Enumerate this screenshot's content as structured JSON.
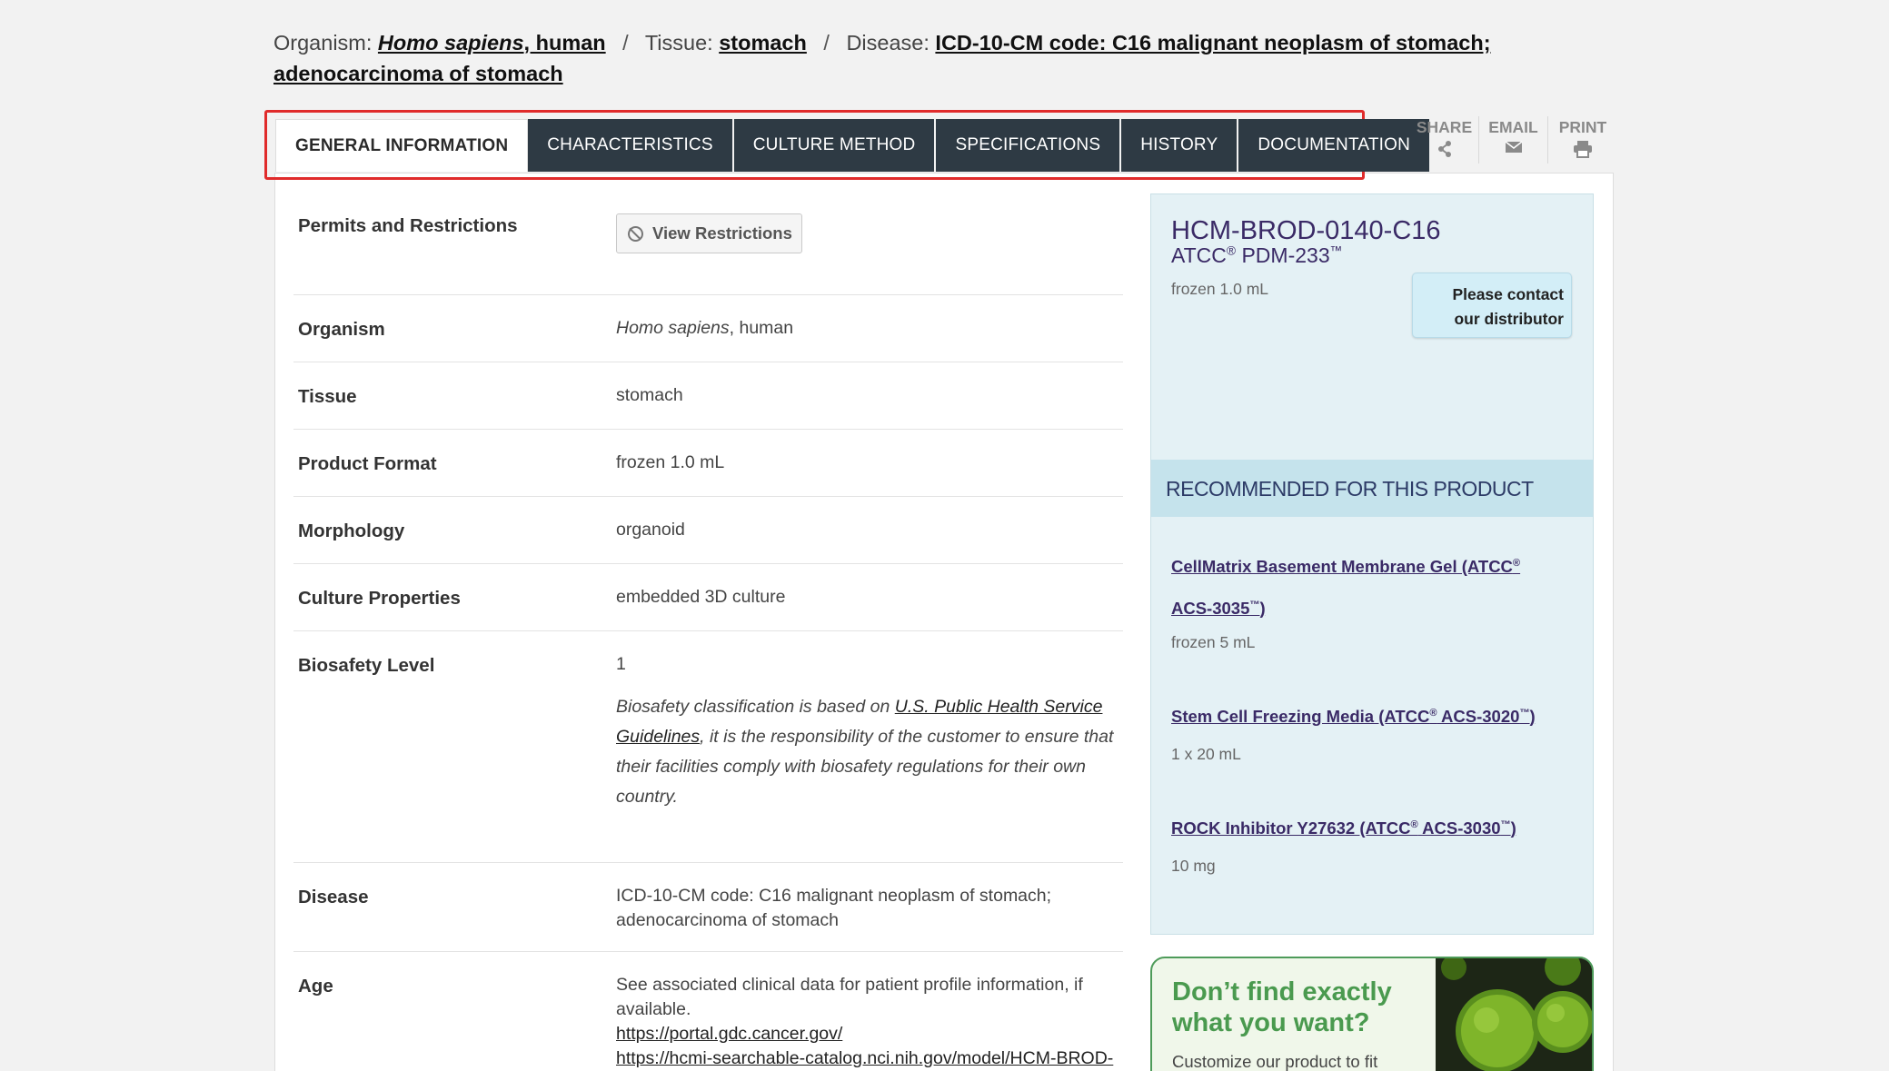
{
  "breadcrumb": {
    "organism_label": "Organism:",
    "organism_value_italic": "Homo sapiens",
    "organism_value_rest": ", human",
    "tissue_label": "Tissue:",
    "tissue_value": "stomach",
    "disease_label": "Disease:",
    "disease_value": "ICD-10-CM code: C16 malignant neoplasm of stomach; adenocarcinoma of stomach",
    "separator": "/"
  },
  "tabs": [
    {
      "label": "GENERAL INFORMATION",
      "active": true
    },
    {
      "label": "CHARACTERISTICS",
      "active": false
    },
    {
      "label": "CULTURE METHOD",
      "active": false
    },
    {
      "label": "SPECIFICATIONS",
      "active": false
    },
    {
      "label": "HISTORY",
      "active": false
    },
    {
      "label": "DOCUMENTATION",
      "active": false
    }
  ],
  "tools": {
    "share": "SHARE",
    "email": "EMAIL",
    "print": "PRINT"
  },
  "details": {
    "permits_label": "Permits and Restrictions",
    "restrictions_button": "View Restrictions",
    "organism_label": "Organism",
    "organism_italic": "Homo sapiens",
    "organism_rest": ", human",
    "tissue_label": "Tissue",
    "tissue_value": "stomach",
    "format_label": "Product Format",
    "format_value": "frozen 1.0 mL",
    "morphology_label": "Morphology",
    "morphology_value": "organoid",
    "culture_label": "Culture Properties",
    "culture_value": "embedded 3D culture",
    "biosafety_label": "Biosafety Level",
    "biosafety_value": "1",
    "biosafety_note_pre": "Biosafety classification is based on ",
    "biosafety_note_link": "U.S. Public Health Service Guidelines",
    "biosafety_note_post": ", it is the responsibility of the customer to ensure that their facilities comply with biosafety regulations for their own country.",
    "disease_label": "Disease",
    "disease_value": "ICD-10-CM code: C16 malignant neoplasm of stomach; adenocarcinoma of stomach",
    "age_label": "Age",
    "age_value": "See associated clinical data for patient profile information, if available.",
    "age_link1": "https://portal.gdc.cancer.gov/",
    "age_link2": "https://hcmi-searchable-catalog.nci.nih.gov/model/HCM-BROD-"
  },
  "product": {
    "id": "HCM-BROD-0140-C16",
    "atcc_prefix": "ATCC",
    "atcc_reg": "®",
    "atcc_code": " PDM-233",
    "atcc_tm": "™",
    "format": "frozen 1.0 mL",
    "contact_line1": "Please contact",
    "contact_line2": "our distributor",
    "recommended_heading": "RECOMMENDED FOR THIS PRODUCT",
    "recommended": [
      {
        "name": "CellMatrix Basement Membrane Gel (ATCC",
        "code": "ACS-3035",
        "size": "frozen 5 mL"
      },
      {
        "name": "Stem Cell Freezing Media (ATCC",
        "code": " ACS-3020",
        "size": "1 x 20 mL"
      },
      {
        "name": "ROCK Inhibitor Y27632 (ATCC",
        "code": " ACS-3030",
        "size": "10 mg"
      }
    ],
    "reg": "®",
    "tm": "™",
    "close_paren": ")"
  },
  "promo": {
    "title_line1": "Don’t find exactly",
    "title_line2": "what you want?",
    "text": "Customize our product to fit"
  },
  "colors": {
    "tab_bg": "#2e3a44",
    "highlight_border": "#e02b2b",
    "product_box_bg": "#e4f1f5",
    "link_purple": "#3a2a66",
    "promo_green": "#4a9a4f"
  }
}
